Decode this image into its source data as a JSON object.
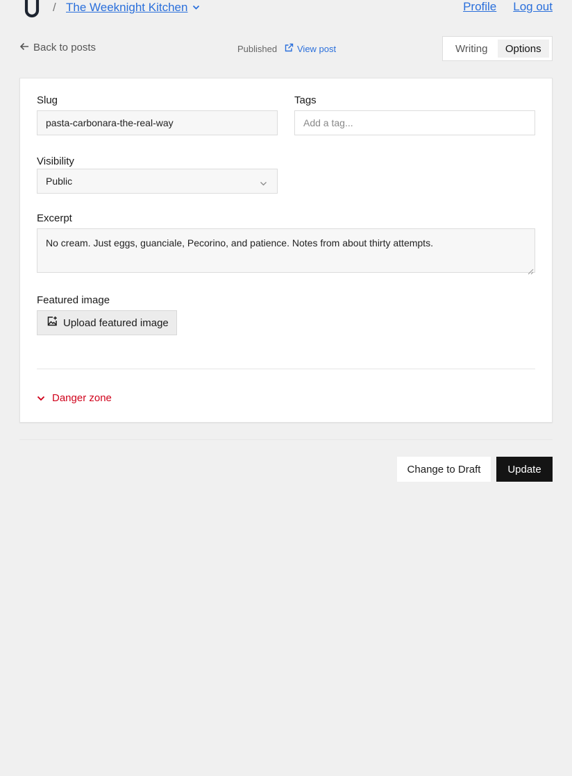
{
  "header": {
    "separator": "/",
    "site_name": "The Weeknight Kitchen",
    "profile_label": "Profile",
    "logout_label": "Log out"
  },
  "subbar": {
    "back_label": "Back to posts",
    "status": "Published",
    "view_post_label": "View post",
    "tabs": [
      {
        "label": "Writing",
        "active": false
      },
      {
        "label": "Options",
        "active": true
      }
    ]
  },
  "options": {
    "slug": {
      "label": "Slug",
      "value": "pasta-carbonara-the-real-way"
    },
    "tags": {
      "label": "Tags",
      "placeholder": "Add a tag..."
    },
    "visibility": {
      "label": "Visibility",
      "value": "Public"
    },
    "excerpt": {
      "label": "Excerpt",
      "value": "No cream. Just eggs, guanciale, Pecorino, and patience. Notes from about thirty attempts."
    },
    "featured_image": {
      "label": "Featured image",
      "button_label": "Upload featured image"
    },
    "danger_zone_label": "Danger zone"
  },
  "actions": {
    "draft_label": "Change to Draft",
    "update_label": "Update"
  },
  "colors": {
    "link": "#2a6fdb",
    "danger": "#d0021b",
    "primary_button": "#141414",
    "background": "#f0f0f0"
  }
}
